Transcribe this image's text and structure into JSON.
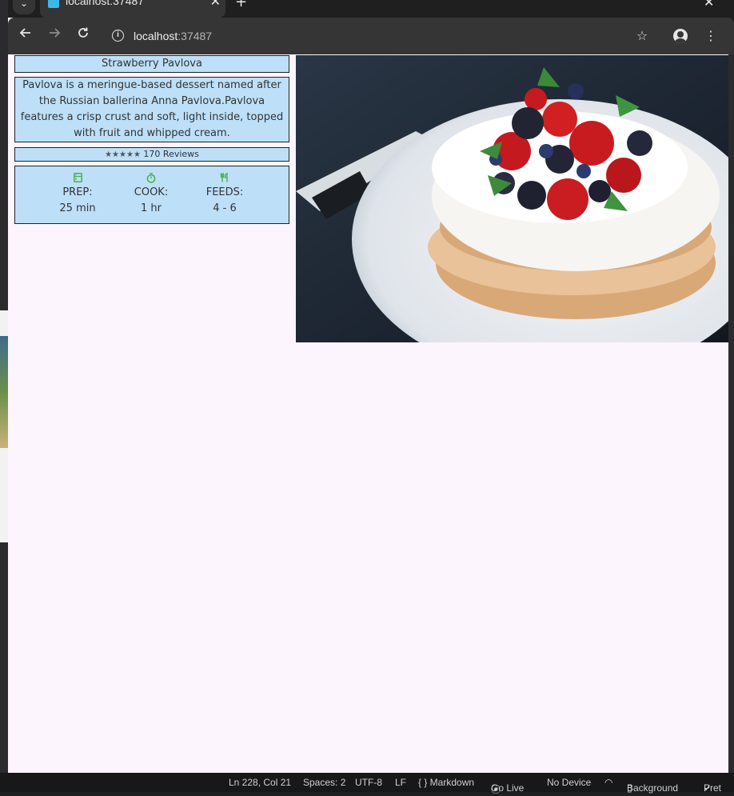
{
  "browser": {
    "tab_title": "localhost:37487",
    "url_host": "localhost",
    "url_port": ":37487"
  },
  "recipe": {
    "title": "Strawberry Pavlova",
    "description": "Pavlova is a meringue-based dessert named after the Russian ballerina Anna Pavlova.Pavlova features a crisp crust and soft, light inside, topped with fruit and whipped cream.",
    "stars": "★★★★★",
    "reviews": "170 Reviews",
    "info": [
      {
        "icon": "kitchen-icon",
        "label": "PREP:",
        "value": "25 min"
      },
      {
        "icon": "timer-icon",
        "label": "COOK:",
        "value": "1 hr"
      },
      {
        "icon": "restaurant-icon",
        "label": "FEEDS:",
        "value": "4 - 6"
      }
    ]
  },
  "statusbar": {
    "position": "Ln 228, Col 21",
    "spaces": "Spaces: 2",
    "encoding": "UTF-8",
    "eol": "LF",
    "language": "{ } Markdown",
    "golive": "Go Live",
    "device": "No Device",
    "background": "Background",
    "prettier": "Pret"
  },
  "colors": {
    "card_bg": "#bde0f8",
    "icon_green": "#4caf50",
    "page_bg": "#fcf5fd"
  }
}
